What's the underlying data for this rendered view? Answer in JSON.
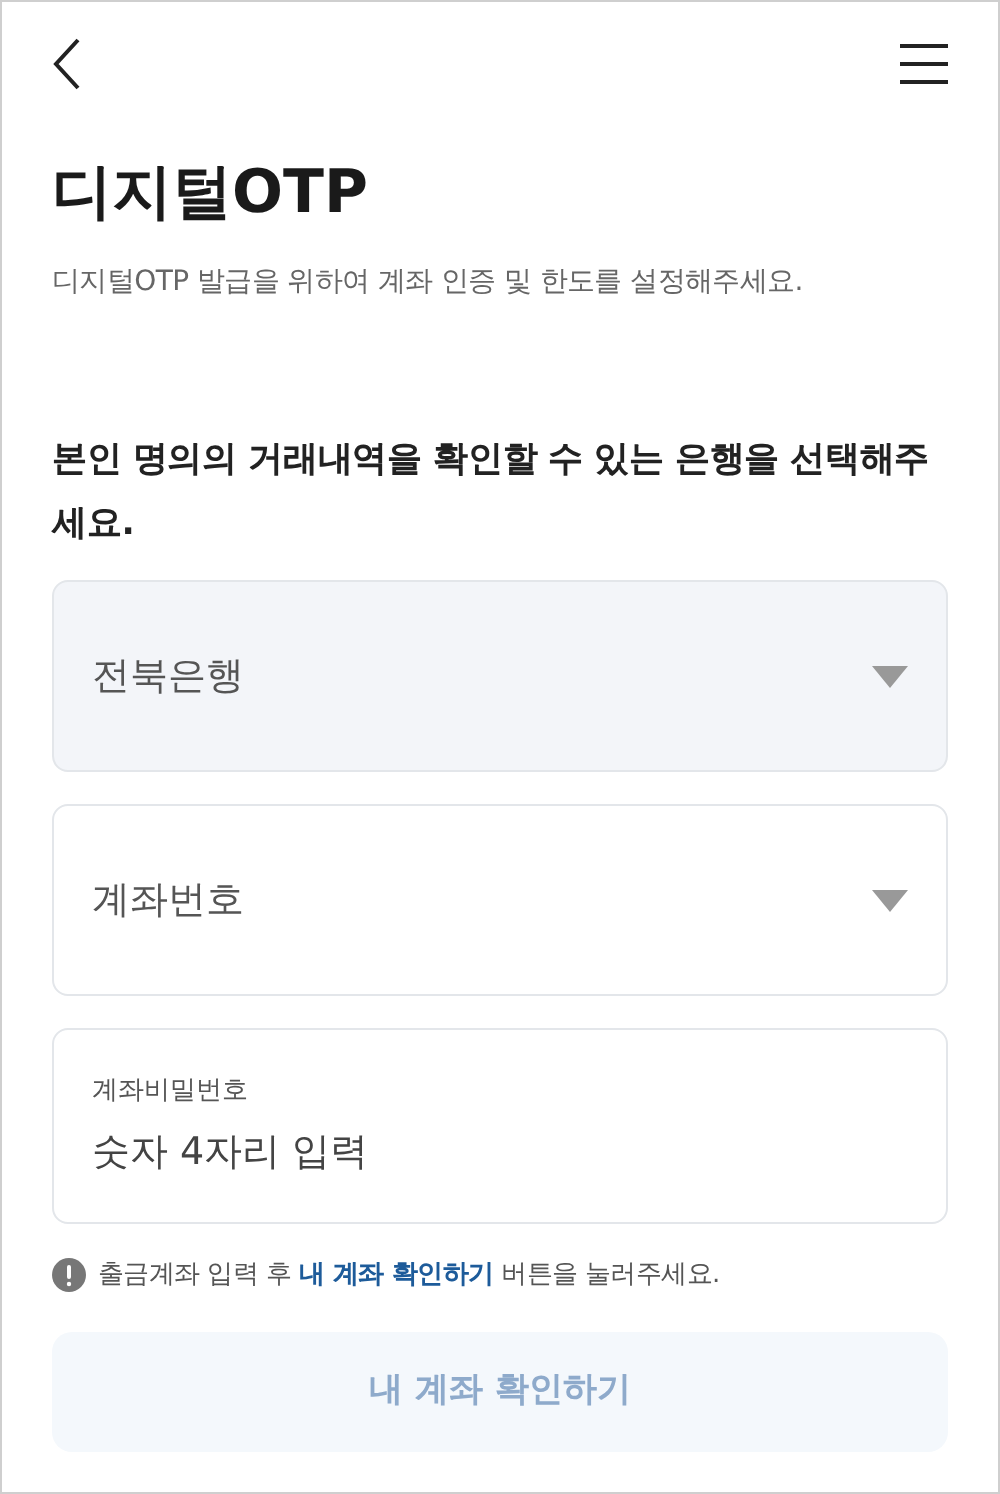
{
  "title": "디지털OTP",
  "subtitle": "디지털OTP 발급을 위하여 계좌 인증 및 한도를 설정해주세요.",
  "question": "본인 명의의 거래내역을 확인할 수 있는 은행을 선택해주세요.",
  "fields": [
    {
      "kind": "select",
      "value": "전북은행",
      "disabled": true
    },
    {
      "kind": "select",
      "placeholder": "계좌번호",
      "disabled": false
    },
    {
      "kind": "input",
      "label": "계좌비밀번호",
      "placeholder": "숫자 4자리 입력",
      "disabled": false
    }
  ],
  "notice": "출금계좌 입력 후 **내 계좌 확인하기** 버튼을 눌러주세요.",
  "button": {
    "label": "내 계좌 확인하기",
    "disabled": true
  }
}
